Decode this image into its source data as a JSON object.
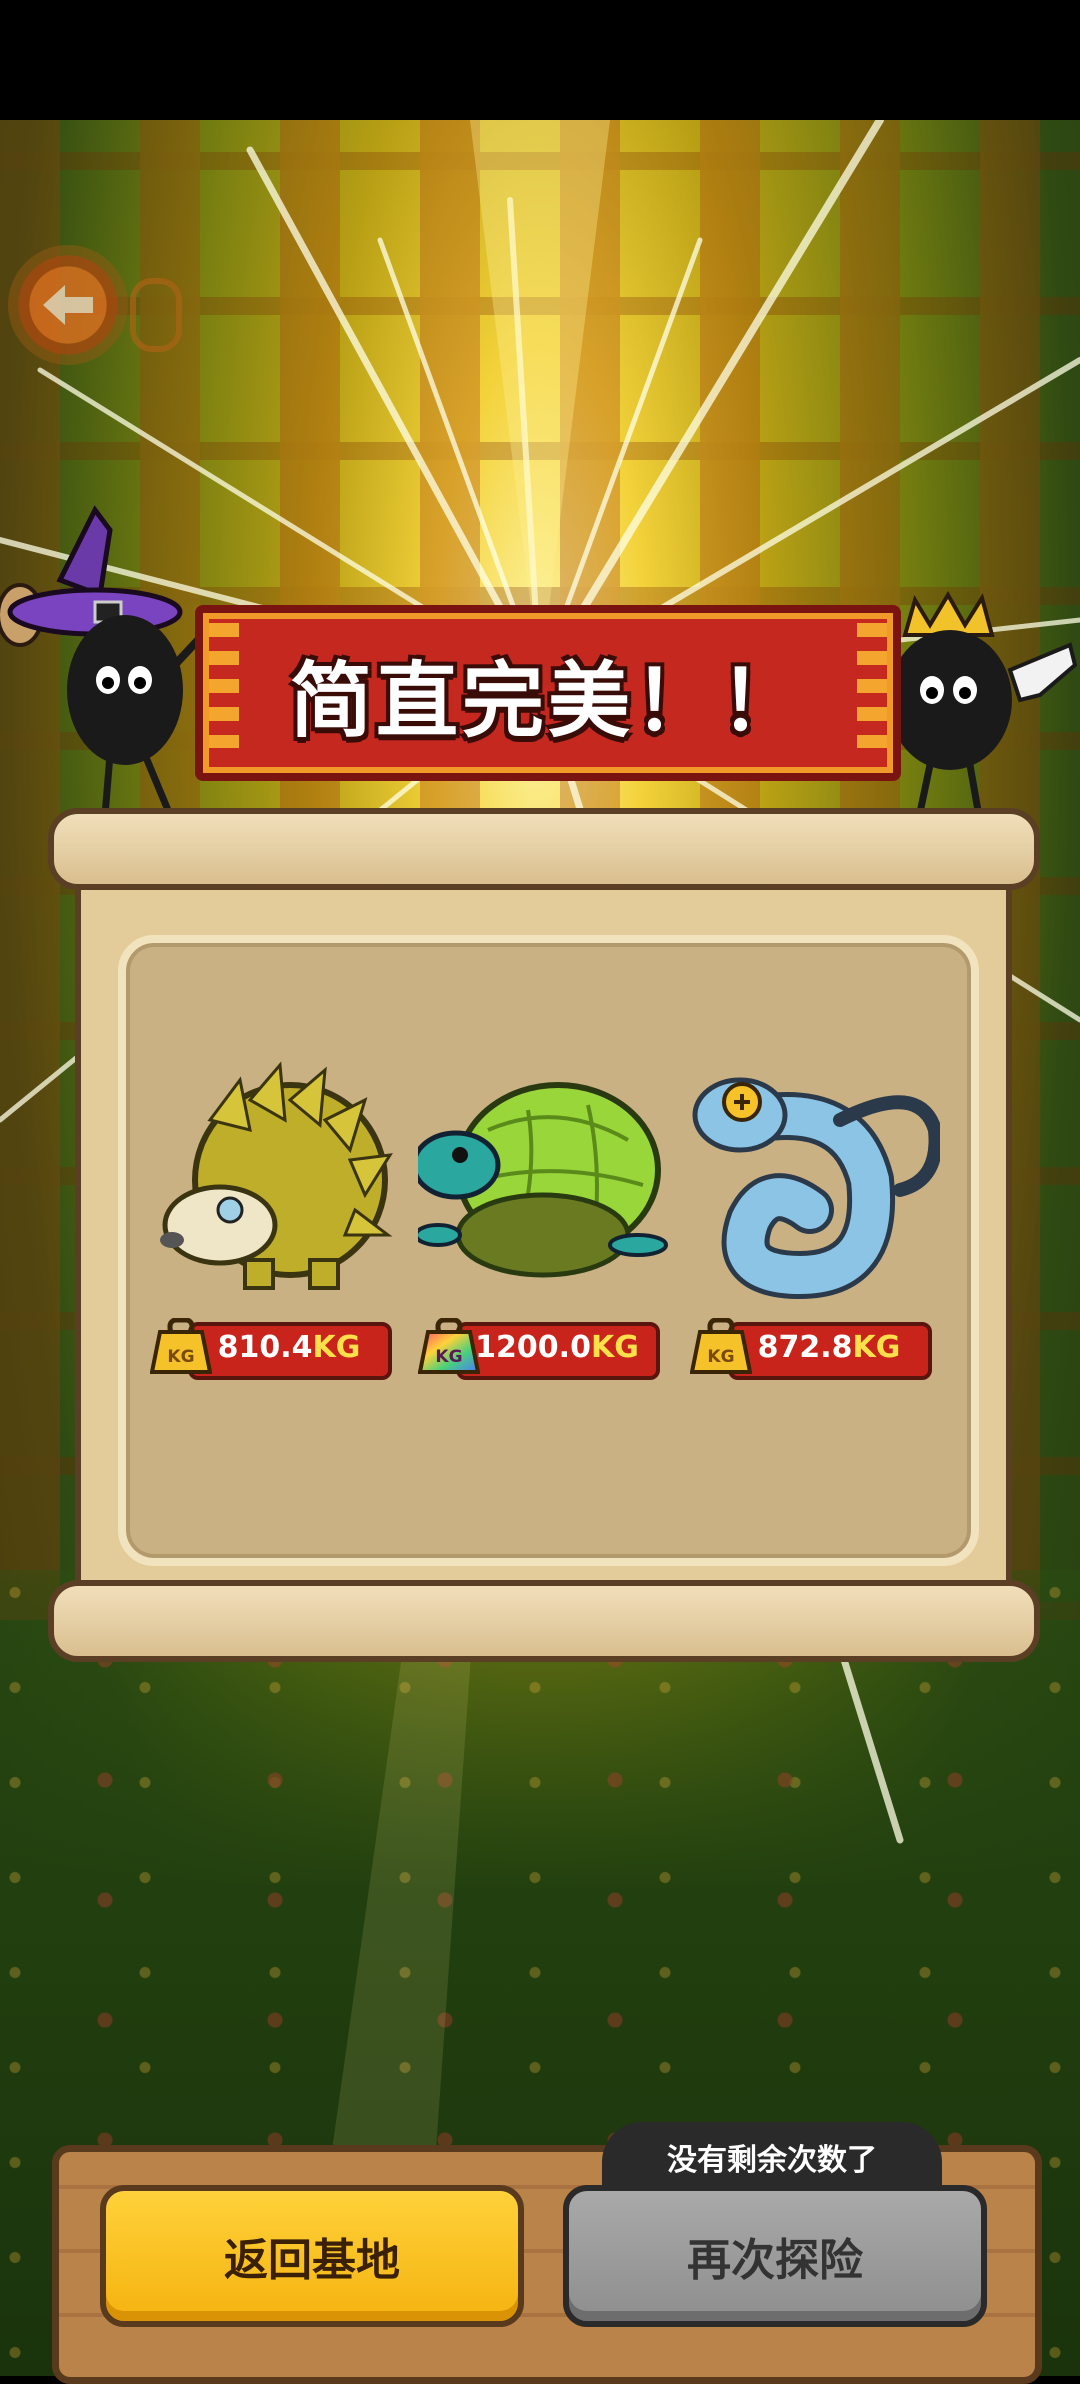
{
  "result": {
    "title": "简直完美！！"
  },
  "catches": [
    {
      "name": "hedgehog",
      "weight_value": "810.4",
      "weight_unit": "KG",
      "weight_icon": "gold-weight-icon"
    },
    {
      "name": "turtle",
      "weight_value": "1200.0",
      "weight_unit": "KG",
      "weight_icon": "rainbow-weight-icon"
    },
    {
      "name": "chameleon",
      "weight_value": "872.8",
      "weight_unit": "KG",
      "weight_icon": "gold-weight-icon"
    }
  ],
  "footer": {
    "home_label": "返回基地",
    "again_label": "再次探险",
    "remaining_notice": "没有剩余次数了"
  },
  "colors": {
    "banner_red": "#c4281e",
    "home_button": "#f5b30f",
    "again_button_disabled": "#8e8e8e"
  }
}
